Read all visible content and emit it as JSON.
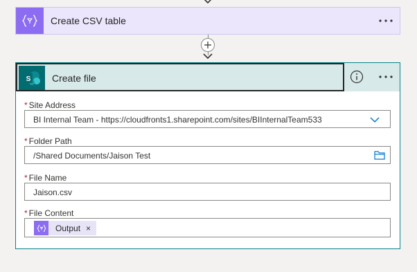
{
  "csv_card": {
    "title": "Create CSV table",
    "icon": "curly-braces-filter-icon",
    "accent": "#8c6cf0",
    "more": "···"
  },
  "connector": {
    "plus": "+"
  },
  "file_card": {
    "title": "Create file",
    "icon": "sharepoint-icon",
    "accent": "#036c70",
    "more": "···",
    "fields": {
      "site_address": {
        "label": "Site Address",
        "required": "*",
        "value": "BI Internal Team - https://cloudfronts1.sharepoint.com/sites/BIInternalTeam533"
      },
      "folder_path": {
        "label": "Folder Path",
        "required": "*",
        "value": "/Shared Documents/Jaison Test"
      },
      "file_name": {
        "label": "File Name",
        "required": "*",
        "value": "Jaison.csv"
      },
      "file_content": {
        "label": "File Content",
        "required": "*",
        "token": {
          "label": "Output",
          "remove": "×"
        }
      }
    }
  }
}
